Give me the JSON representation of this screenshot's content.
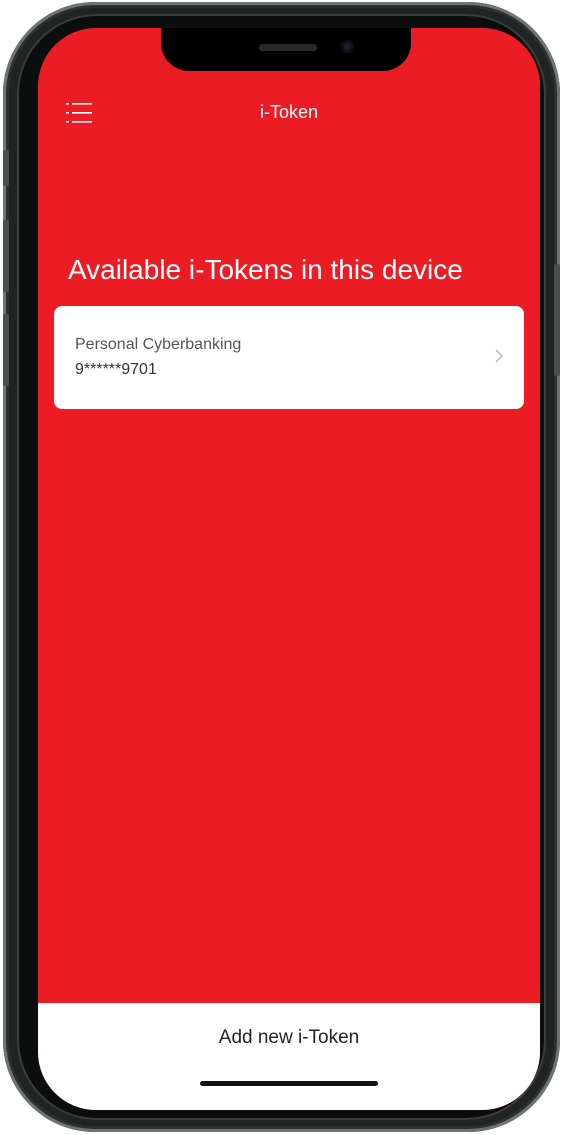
{
  "header": {
    "title": "i-Token",
    "menu_icon": "hamburger-list-icon"
  },
  "main": {
    "heading": "Available i-Tokens in this device",
    "tokens": [
      {
        "name": "Personal Cyberbanking",
        "number": "9******9701",
        "icon": "chevron-right-icon"
      }
    ]
  },
  "footer": {
    "add_button_label": "Add new i-Token"
  },
  "colors": {
    "brand_red": "#ec1c24",
    "card_bg": "#ffffff",
    "text_on_brand": "#ffffff"
  }
}
